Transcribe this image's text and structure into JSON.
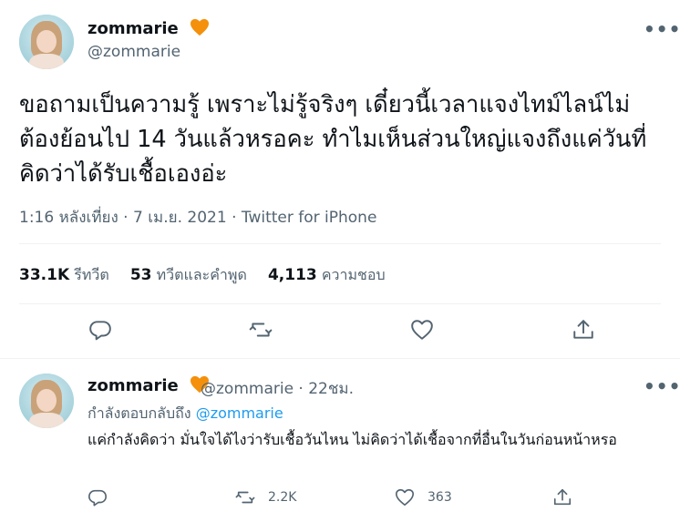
{
  "tweet": {
    "display_name": "zommarie",
    "handle": "@zommarie",
    "text": "ขอถามเป็นความรู้ เพราะไม่รู้จริงๆ เดี๋ยวนี้เวลาแจงไทม์ไลน์ไม่ต้องย้อนไป 14 วันแล้วหรอคะ ทำไมเห็นส่วนใหญ่แจงถึงแค่วันที่คิดว่าได้รับเชื้อเองอ่ะ",
    "meta": "1:16 หลังเที่ยง · 7 เม.ย. 2021 · Twitter for iPhone",
    "retweets_count": "33.1K",
    "retweets_label": "รีทวีต",
    "quotes_count": "53",
    "quotes_label": "ทวีตและคำพูด",
    "likes_count": "4,113",
    "likes_label": "ความชอบ",
    "more_label": "•••"
  },
  "reply": {
    "display_name": "zommarie",
    "handle_time": "@zommarie · 22ชม.",
    "replying_prefix": "กำลังตอบกลับถึง",
    "replying_mention": "@zommarie",
    "text": "แค่กำลังคิดว่า มั่นใจได้ไงว่ารับเชื้อวันไหน ไม่คิดว่าได้เชื้อจากที่อื่นในวันก่อนหน้าหรอ",
    "retweet_count": "2.2K",
    "like_count": "363",
    "more_label": "•••"
  },
  "colors": {
    "text": "#0f1419",
    "secondary": "#536471",
    "accent": "#1d9bf0",
    "heart": "#f4900c",
    "divider": "#eff3f4"
  },
  "icons": [
    "heart-emoji-icon",
    "reply-icon",
    "retweet-icon",
    "like-icon",
    "share-icon",
    "more-icon"
  ]
}
